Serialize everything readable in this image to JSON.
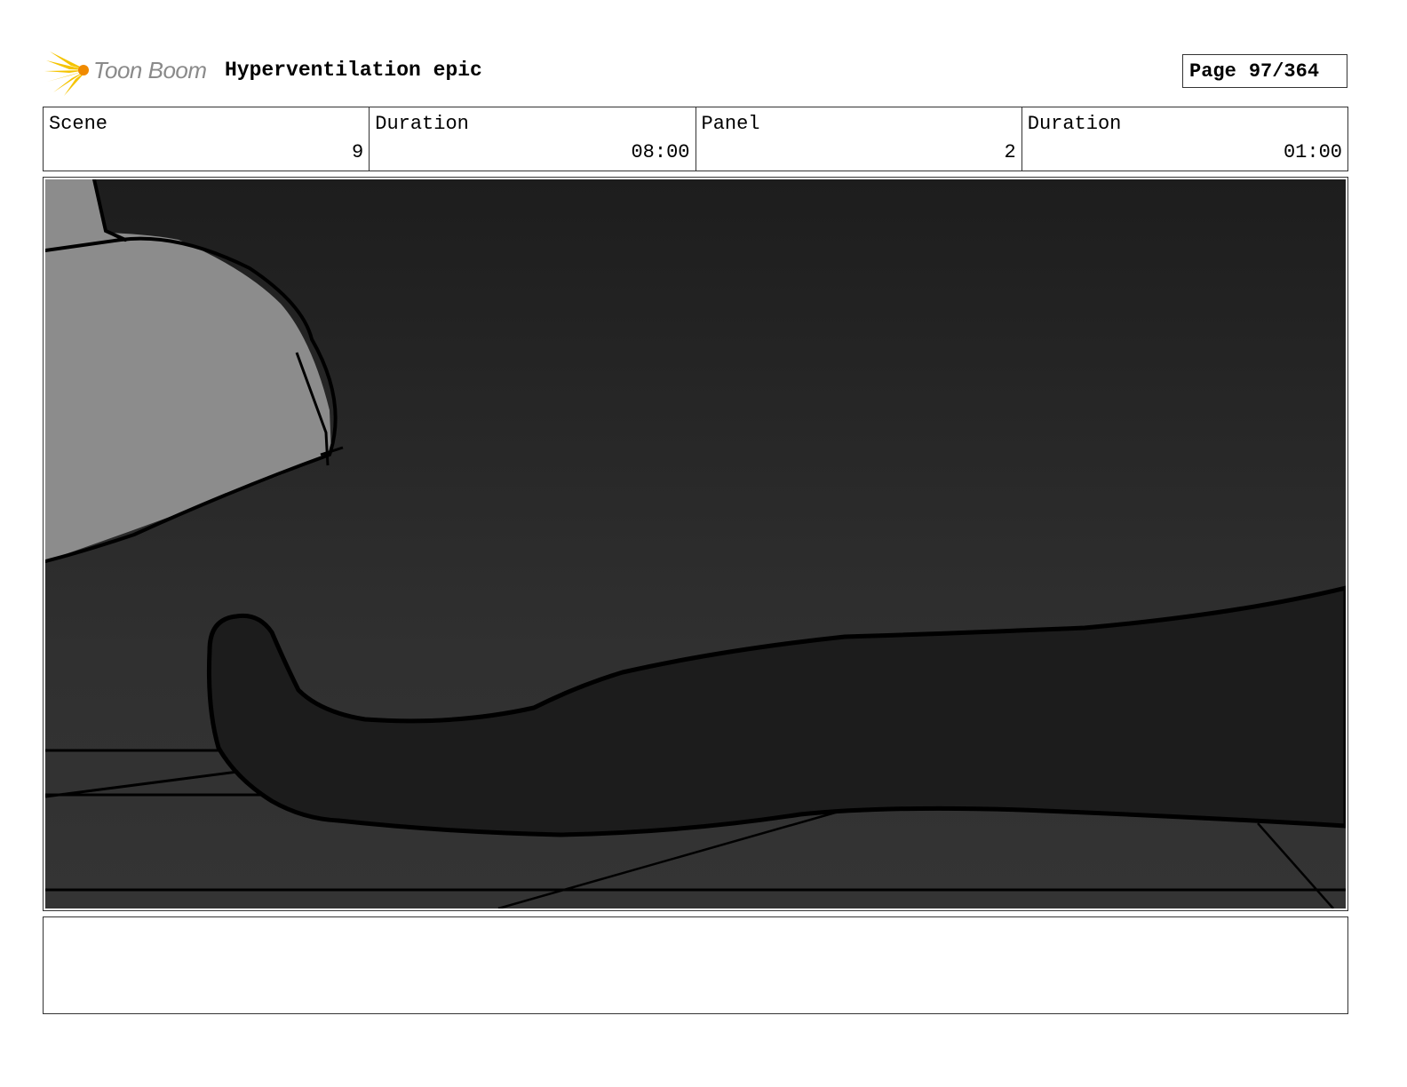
{
  "header": {
    "logo_text": "Toon Boom",
    "title": "Hyperventilation epic",
    "page_label": "Page",
    "page_number": "97/364"
  },
  "info": {
    "scene_label": "Scene",
    "scene_value": "9",
    "scene_duration_label": "Duration",
    "scene_duration_value": "08:00",
    "panel_label": "Panel",
    "panel_value": "2",
    "panel_duration_label": "Duration",
    "panel_duration_value": "01:00"
  },
  "notes": {
    "text": ""
  },
  "colors": {
    "logo_burst": "#f5c400",
    "logo_text": "#8a8a8a",
    "panel_background": "#2a2a2a",
    "light_shape": "#8c8c8c",
    "leg_shape": "#1c1c1c",
    "lines": "#000000"
  }
}
